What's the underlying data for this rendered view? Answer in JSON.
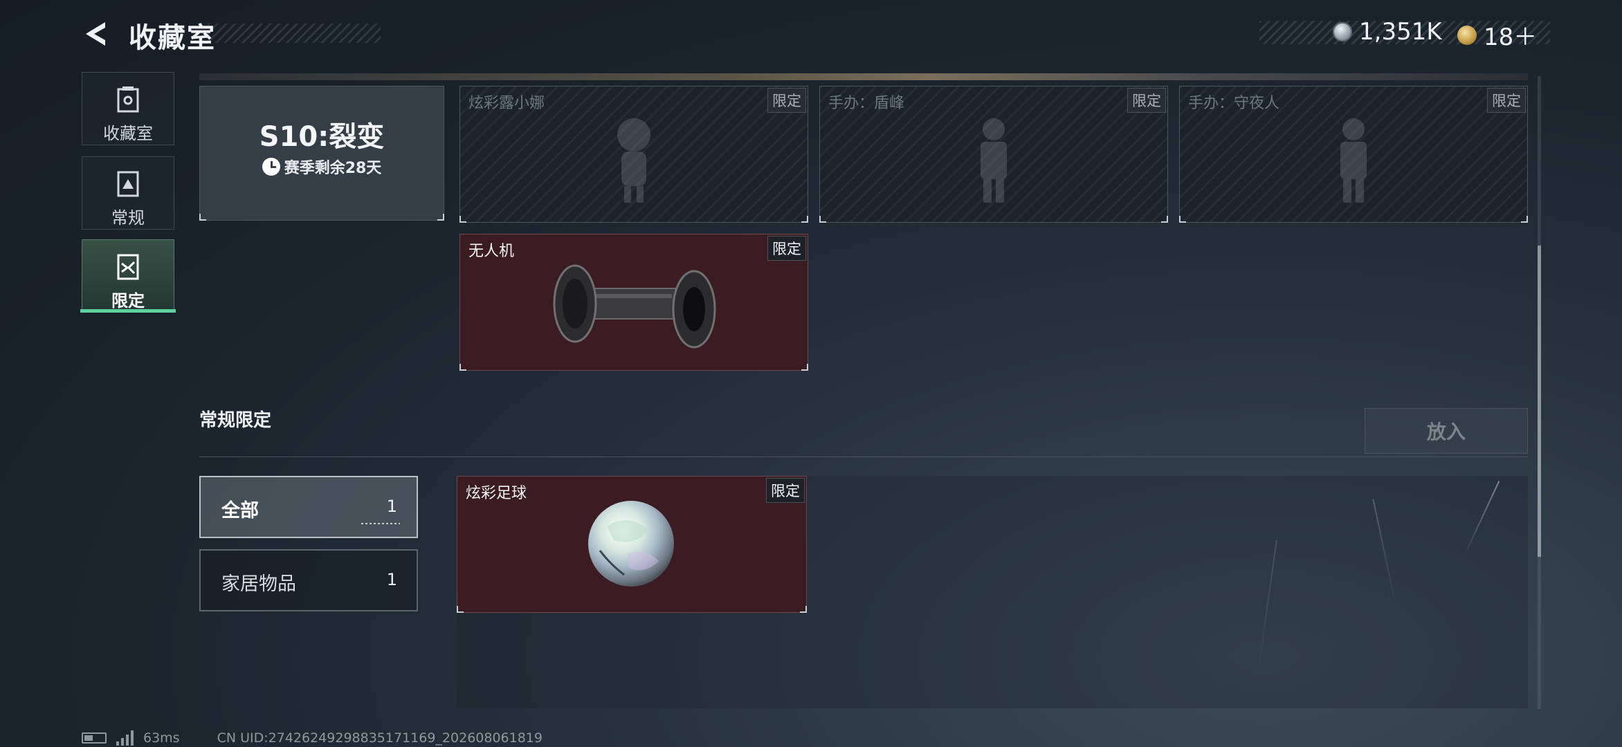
{
  "header": {
    "title": "收藏室",
    "currencies": [
      {
        "icon": "silver-coin-icon",
        "value": "1,351K"
      },
      {
        "icon": "gold-coin-icon",
        "value": "18＋"
      }
    ]
  },
  "nav": [
    {
      "label": "收藏室",
      "icon": "collection-room-icon"
    },
    {
      "label": "常规",
      "icon": "regular-card-icon"
    },
    {
      "label": "限定",
      "icon": "limited-card-icon",
      "selected": true
    }
  ],
  "season": {
    "title": "S10:裂变",
    "remaining": "赛季剩余28天"
  },
  "season_items": [
    {
      "name": "炫彩露小娜",
      "tag": "限定",
      "state": "locked"
    },
    {
      "name": "手办：盾峰",
      "tag": "限定",
      "state": "locked"
    },
    {
      "name": "手办：守夜人",
      "tag": "限定",
      "state": "locked"
    },
    {
      "name": "无人机",
      "tag": "限定",
      "state": "owned"
    }
  ],
  "section": {
    "title": "常规限定",
    "put_button": "放入"
  },
  "filters": [
    {
      "label": "全部",
      "count": "1",
      "selected": true
    },
    {
      "label": "家居物品",
      "count": "1"
    }
  ],
  "regular_items": [
    {
      "name": "炫彩足球",
      "tag": "限定",
      "state": "owned"
    }
  ],
  "status": {
    "ping": "63ms",
    "uid": "CN UID:274262492988351711​69_202608061819"
  },
  "colors": {
    "accent": "#5ed3a0",
    "owned_card": "#3b1c22",
    "locked_card": "#1c232b"
  }
}
